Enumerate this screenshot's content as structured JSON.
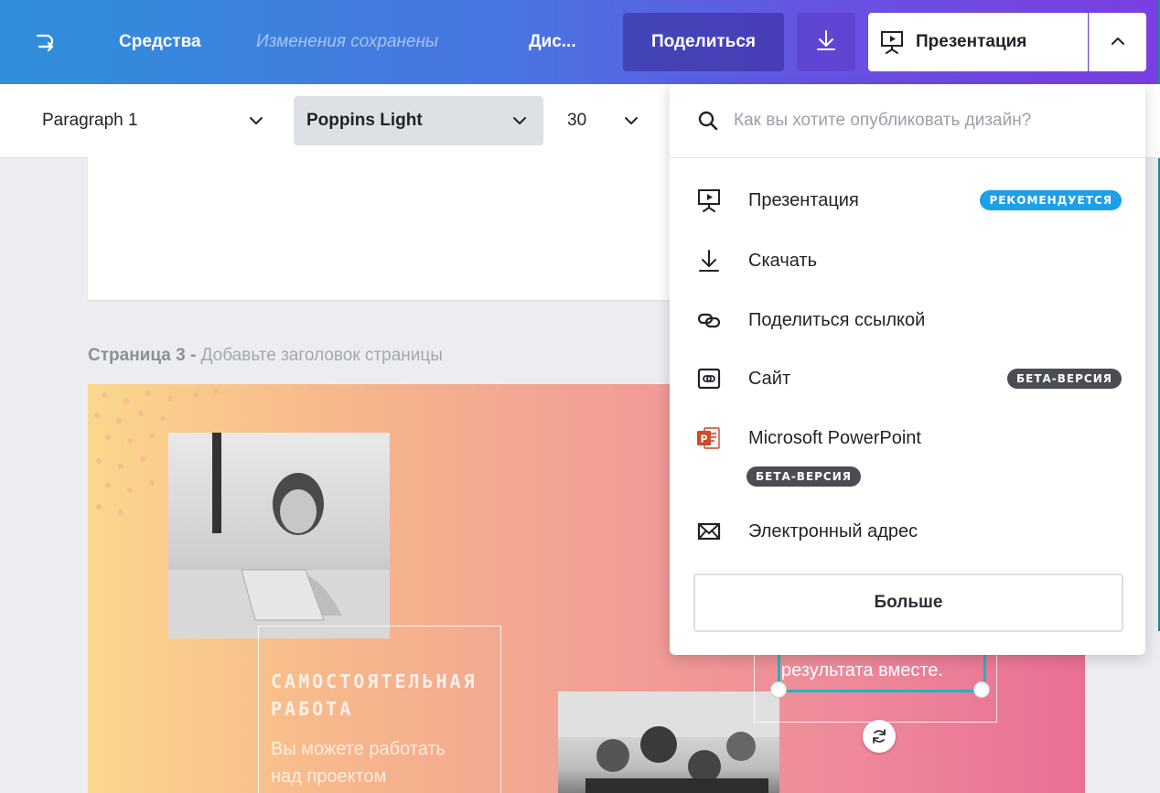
{
  "topbar": {
    "undo_icon": "redo-arrow-icon",
    "tools_label": "Средства",
    "saved_status": "Изменения сохранены",
    "truncated_label": "Дис...",
    "share_label": "Поделиться",
    "download_icon": "download-icon",
    "present_label": "Презентация",
    "present_icon": "presentation-icon",
    "caret_icon": "chevron-up-icon"
  },
  "text_toolbar": {
    "paragraph_style": "Paragraph 1",
    "font_family_value": "Poppins Light",
    "font_size_value": "30"
  },
  "canvas": {
    "page3_label": "Страница 3 -",
    "page3_title_placeholder": "Добавьте заголовок страницы",
    "slide_heading_line1": "САМОСТОЯТЕЛЬНАЯ",
    "slide_heading_line2": "РАБОТА",
    "slide_body_line1": "Вы можете работать",
    "slide_body_line2": "над проектом",
    "selected_text": "результата вместе."
  },
  "publish_menu": {
    "search_placeholder": "Как вы хотите опубликовать дизайн?",
    "items": [
      {
        "label": "Презентация",
        "icon": "presentation-icon",
        "badge": "РЕКОМЕНДУЕТСЯ"
      },
      {
        "label": "Скачать",
        "icon": "download-icon",
        "badge": ""
      },
      {
        "label": "Поделиться ссылкой",
        "icon": "link-icon",
        "badge": ""
      },
      {
        "label": "Сайт",
        "icon": "website-icon",
        "badge": "БЕТА-ВЕРСИЯ"
      },
      {
        "label": "Microsoft PowerPoint",
        "icon": "powerpoint-icon",
        "badge": "БЕТА-ВЕРСИЯ"
      },
      {
        "label": "Электронный адрес",
        "icon": "email-icon",
        "badge": ""
      }
    ],
    "more_label": "Больше"
  },
  "colors": {
    "topbar_start": "#2f8fdc",
    "topbar_end": "#7b3ee2",
    "recommended_badge": "#1ea0e8",
    "beta_badge": "#4a4d52",
    "selection": "#19b6c6"
  }
}
